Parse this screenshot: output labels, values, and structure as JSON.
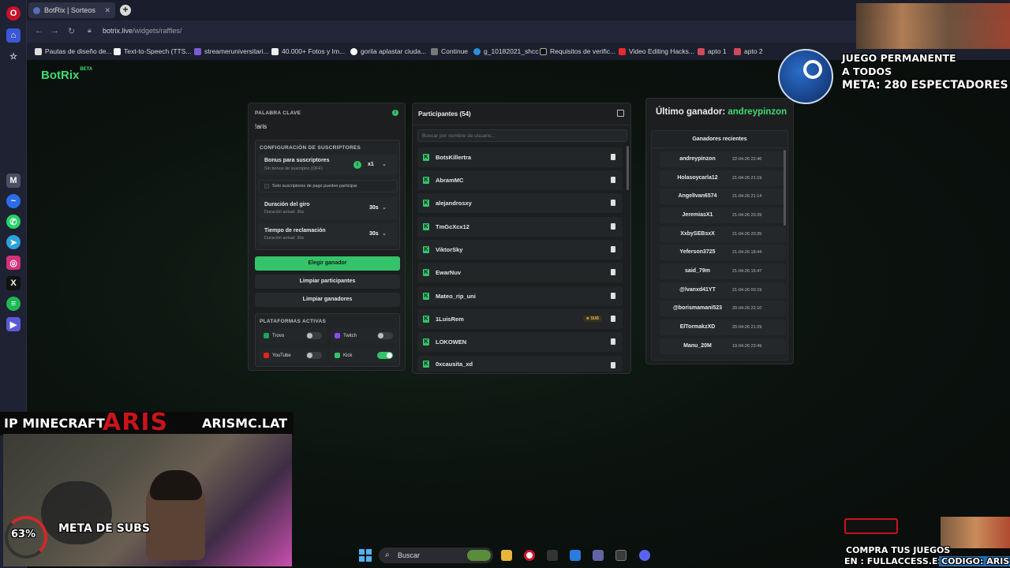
{
  "browser": {
    "tab_title": "BotRix | Sorteos",
    "url_host": "botrix.live",
    "url_path": "/widgets/raffles/",
    "bookmarks": [
      "Pautas de diseño de...",
      "Text-to-Speech (TTS...",
      "streameruniversitari...",
      "40.000+ Fotos y Im...",
      "gorila aplastar ciuda...",
      "Continue",
      "g_10182021_shcc",
      "Requisitos de verific...",
      "Video Editing Hacks...",
      "apto 1",
      "apto 2"
    ]
  },
  "app": {
    "logo": "BotRix",
    "logo_badge": "BETA"
  },
  "config": {
    "keyword_label": "PALABRA CLAVE",
    "keyword_value": "!aris",
    "sub_config_label": "CONFIGURACIÓN DE SUSCRIPTORES",
    "bonus_title": "Bonus para suscriptores",
    "bonus_sub": "Sin bonus de suscriptor (OFF)",
    "bonus_value": "x1",
    "paid_only": "Solo suscriptores de pago pueden participar",
    "spin_title": "Duración del giro",
    "spin_sub": "Duración actual: 30s",
    "spin_value": "30s",
    "claim_title": "Tiempo de reclamación",
    "claim_sub": "Duración actual: 30s",
    "claim_value": "30s",
    "pick_winner": "Elegir ganador",
    "clear_participants": "Limpiar participantes",
    "clear_winners": "Limpiar ganadores",
    "platforms_label": "PLATAFORMAS ACTIVAS",
    "platforms": [
      {
        "name": "Trovo",
        "on": false
      },
      {
        "name": "Twitch",
        "on": false
      },
      {
        "name": "YouTube",
        "on": false
      },
      {
        "name": "Kick",
        "on": true
      }
    ]
  },
  "participants": {
    "title": "Participantes (54)",
    "search_placeholder": "Buscar por nombre de usuario...",
    "sub_badge": "SUB",
    "list": [
      "BotsKillertra",
      "AbramMC",
      "alejandrosxy",
      "TmGcXcx12",
      "ViktorSky",
      "EwarNuv",
      "Mateo_rip_uni",
      "1LuisRem",
      "LOKOWEN",
      "0xcausita_xd"
    ]
  },
  "winners": {
    "last_label": "Último ganador:",
    "last_name": "andreypinzon",
    "recent_label": "Ganadores recientes",
    "list": [
      {
        "name": "andreypinzon",
        "date": "22-04-26 22:46"
      },
      {
        "name": "Holasoycarla12",
        "date": "21-04-26 21:19"
      },
      {
        "name": "AngelIvan6574",
        "date": "21-04-26 21:14"
      },
      {
        "name": "JeremiasX1",
        "date": "21-04-26 20:39"
      },
      {
        "name": "XxbySEBsxX",
        "date": "21-04-26 20:35"
      },
      {
        "name": "Yeferson3725",
        "date": "21-04-26 18:44"
      },
      {
        "name": "said_79m",
        "date": "21-04-26 16:47"
      },
      {
        "name": "@lvanxd41YT",
        "date": "21-04-26 00:19"
      },
      {
        "name": "@borismamani523",
        "date": "20-04-26 22:10"
      },
      {
        "name": "ElTormakzXD",
        "date": "20-04-26 21:29"
      },
      {
        "name": "Manu_20M",
        "date": "19-04-26 23:49"
      }
    ]
  },
  "overlays": {
    "steam_line1": "JUEGO PERMANENTE",
    "steam_line2": "A TODOS",
    "steam_meta": "META:",
    "steam_goal": "280 ESPECTADORES",
    "ip_label": "IP MINECRAFT",
    "aris": "ARIS",
    "server": "ARISMC.LAT",
    "subs_pct": "63%",
    "subs_label": "META DE SUBS",
    "fa_line1": "COMPRA TUS JUEGOS",
    "fa_line2": "EN : FULLACCESS.ES",
    "fa_code": "CODIGO: ARIS"
  },
  "taskbar": {
    "search": "Buscar"
  },
  "colors": {
    "accent": "#34c36a",
    "card": "#1c1e1f"
  }
}
